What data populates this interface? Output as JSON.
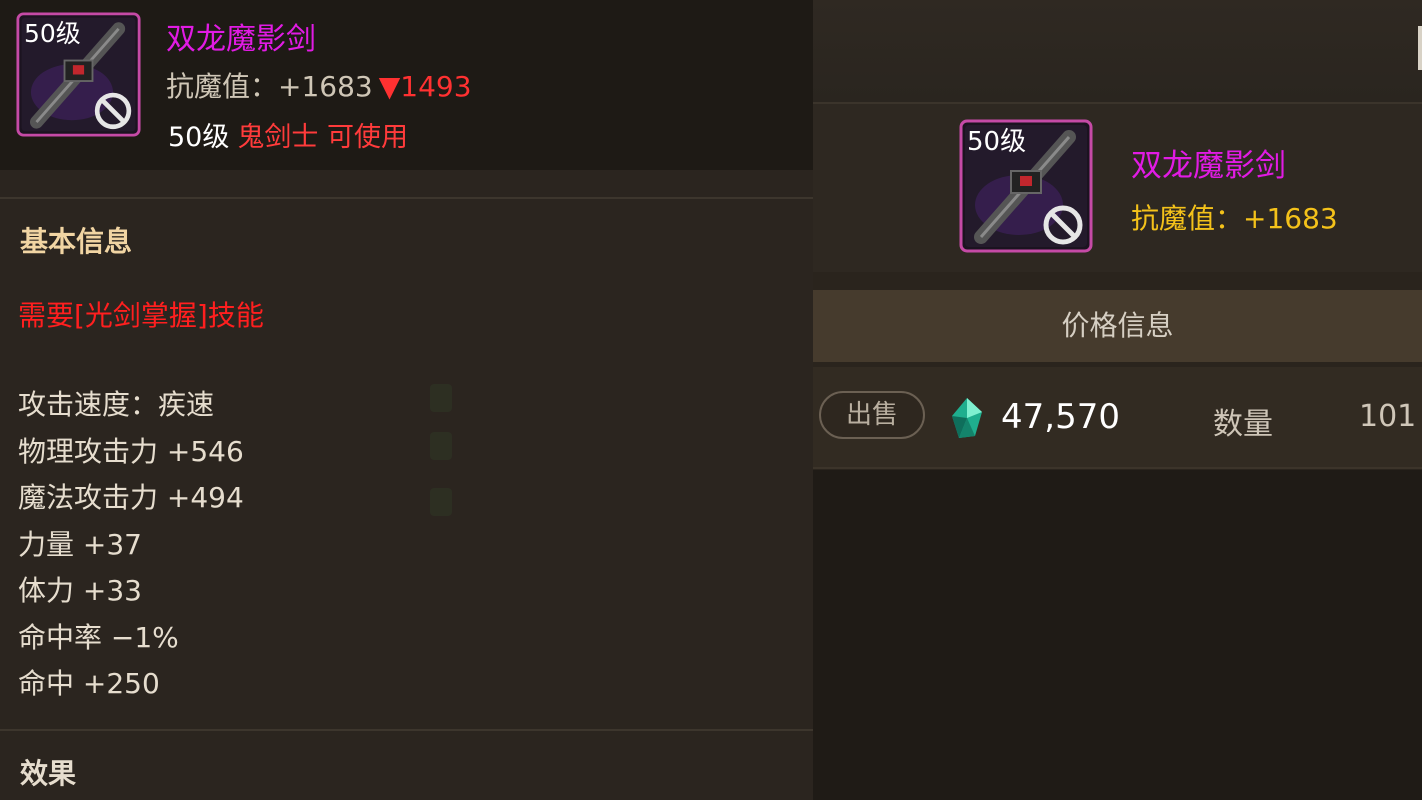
{
  "right_panel": {
    "item": {
      "level_badge": "50级",
      "name": "双龙魔影剑",
      "stat": "抗魔值：+1683"
    },
    "price_header": "价格信息",
    "sale_row": {
      "sell_button": "出售",
      "price": "47,570",
      "qty_label": "数量",
      "qty_value": "101"
    }
  },
  "tooltip": {
    "level_badge": "50级",
    "name": "双龙魔影剑",
    "stat": "抗魔值：+1683",
    "stat_diff": "▼1493",
    "level_text": "50级",
    "class_text": "鬼剑士 可使用",
    "basic_title": "基本信息",
    "requirement": "需要[光剑掌握]技能",
    "stats": [
      "攻击速度：疾速",
      "物理攻击力 +546",
      "魔法攻击力 +494",
      "力量 +37",
      "体力 +33",
      "命中率 −1%",
      "命中 +250"
    ],
    "effect_title": "效果"
  },
  "colors": {
    "item_name": "#e11be4",
    "stat_gold": "#f4c21a",
    "warning_red": "#ff1f1f",
    "section_title": "#f1d5a3"
  }
}
